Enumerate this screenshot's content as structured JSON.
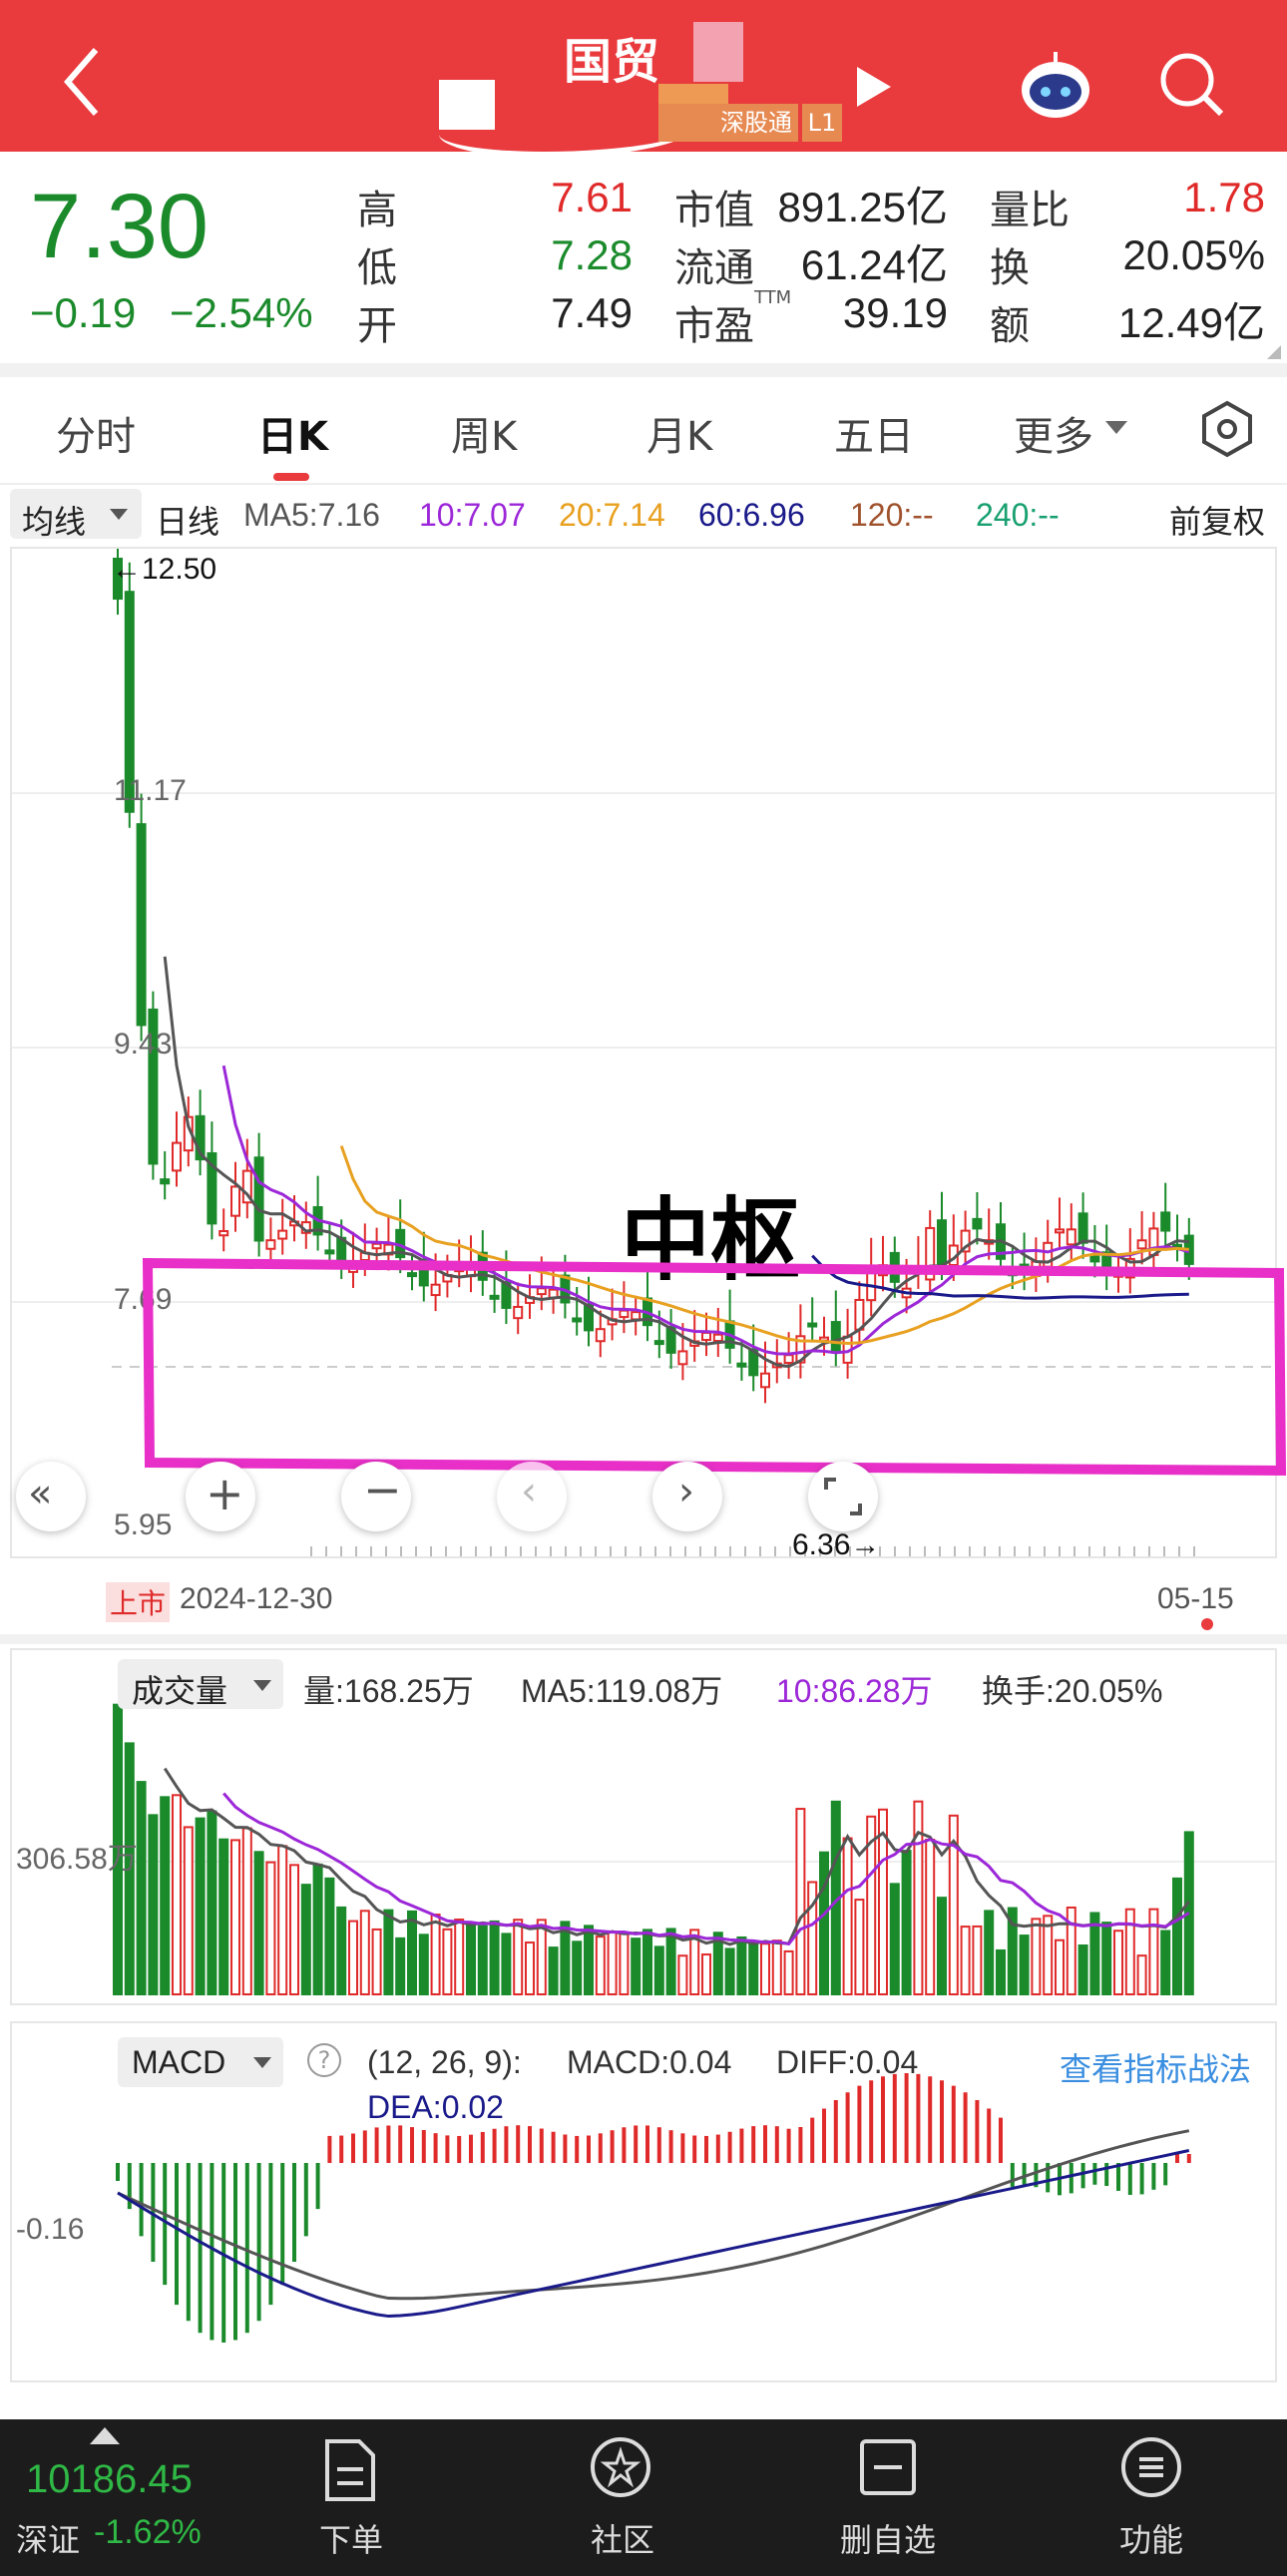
{
  "header": {
    "title": "国贸",
    "tag_market": "深股通",
    "tag_level": "L1"
  },
  "quote": {
    "price": "7.30",
    "change": "−0.19",
    "change_pct": "−2.54%",
    "high_label": "高",
    "high": "7.61",
    "low_label": "低",
    "low": "7.28",
    "open_label": "开",
    "open": "7.49",
    "mcap_label": "市值",
    "mcap": "891.25亿",
    "float_label": "流通",
    "float": "61.24亿",
    "pe_label": "市盈",
    "pe_sup": "TTM",
    "pe": "39.19",
    "vr_label": "量比",
    "vr": "1.78",
    "turnover_label": "换",
    "turnover": "20.05%",
    "amount_label": "额",
    "amount": "12.49亿"
  },
  "tabs": [
    "分时",
    "日K",
    "周K",
    "月K",
    "五日",
    "更多"
  ],
  "ma_row": {
    "dropdown": "均线",
    "period": "日线",
    "ma5": "MA5:7.16",
    "ma10": "10:7.07",
    "ma20": "20:7.14",
    "ma60": "60:6.96",
    "ma120": "120:--",
    "ma240": "240:--",
    "adjust": "前复权"
  },
  "kchart": {
    "y_labels": [
      "11.17",
      "9.43",
      "7.69",
      "5.95"
    ],
    "max_label": "←12.50",
    "min_label": "6.36→",
    "annotation": "中枢",
    "start_tag": "上市",
    "start_date": "2024-12-30",
    "end_date": "05-15"
  },
  "volume": {
    "dropdown": "成交量",
    "vol": "量:168.25万",
    "ma5": "MA5:119.08万",
    "ma10": "10:86.28万",
    "turnover": "换手:20.05%",
    "y_label": "306.58万"
  },
  "macd": {
    "dropdown": "MACD",
    "params": "(12, 26, 9):",
    "macd": "MACD:0.04",
    "diff": "DIFF:0.04",
    "dea": "DEA:0.02",
    "link": "查看指标战法",
    "y_label": "-0.16"
  },
  "bottom": {
    "index_value": "10186.45",
    "index_name": "深证",
    "index_change": "-1.62%",
    "items": [
      "下单",
      "社区",
      "删自选",
      "功能"
    ]
  },
  "colors": {
    "up": "#e02a2a",
    "down": "#1a8a2b",
    "brand": "#e93a3d",
    "annotation": "#e830c8",
    "ma5": "#555555",
    "ma10": "#9c27d8",
    "ma20": "#e8a020",
    "ma60": "#1a1a8a"
  }
}
